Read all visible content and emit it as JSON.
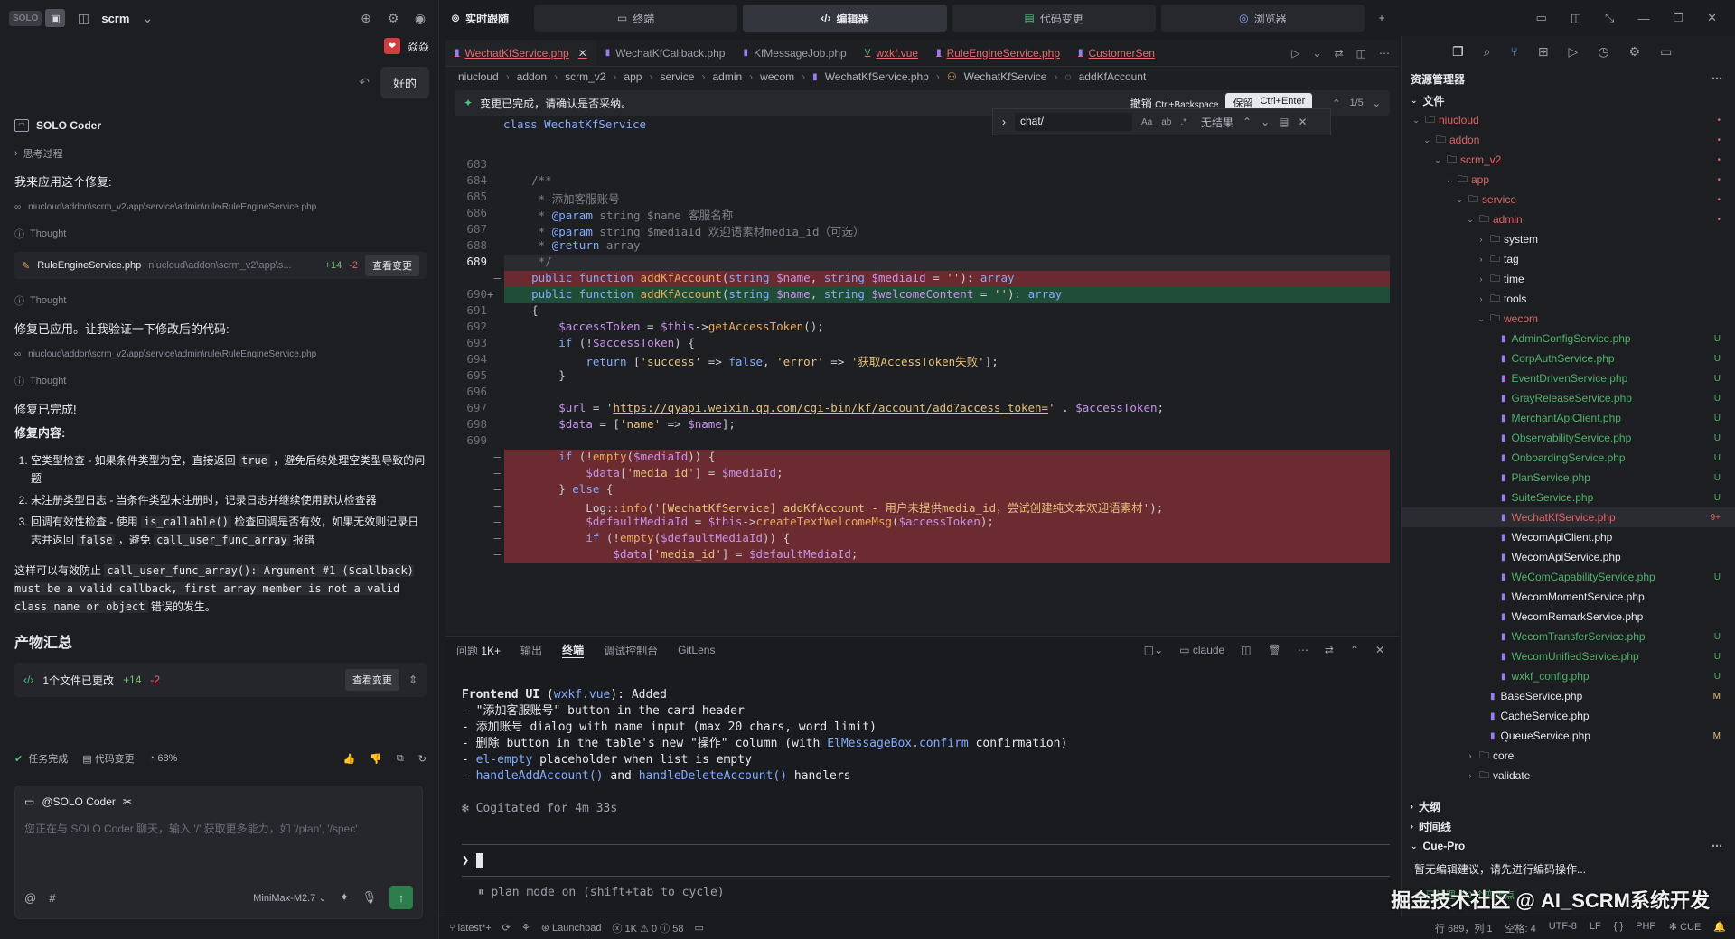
{
  "app": {
    "project": "scrm",
    "logo_text": "SOLO"
  },
  "user": {
    "name": "焱焱",
    "reply": "好的"
  },
  "chat": {
    "agent": "SOLO Coder",
    "thinking": "思考过程",
    "p1": "我来应用这个修复:",
    "ref1": "niucloud\\addon\\scrm_v2\\app\\service\\admin\\rule\\RuleEngineService.php",
    "thought1": "Thought",
    "change_file": "RuleEngineService.php",
    "change_path": "niucloud\\addon\\scrm_v2\\app\\s...",
    "change_add": "+14",
    "change_del": "-2",
    "view_changes": "查看变更",
    "thought2": "Thought",
    "p2": "修复已应用。让我验证一下修改后的代码:",
    "ref2": "niucloud\\addon\\scrm_v2\\app\\service\\admin\\rule\\RuleEngineService.php",
    "thought3": "Thought",
    "p3": "修复已完成!",
    "p4": "修复内容:",
    "item1a": "空类型检查 - 如果条件类型为空，直接返回 ",
    "item1code": "true",
    "item1b": " ，避免后续处理空类型导致的问题",
    "item2": "未注册类型日志 - 当条件类型未注册时，记录日志并继续使用默认检查器",
    "item3a": "回调有效性检查 - 使用 ",
    "item3code": "is_callable()",
    "item3b": " 检查回调是否有效，如果无效则记录日志并返回 ",
    "item3code2": "false",
    "item3c": " ，避免 ",
    "item3code3": "call_user_func_array",
    "item3d": " 报错",
    "p5a": "这样可以有效防止 ",
    "p5code": "call_user_func_array(): Argument #1 ($callback) must be a valid callback, first array member is not a valid class name or object",
    "p5b": " 错误的发生。",
    "section": "产物汇总",
    "summary_text": "1个文件已更改",
    "summary_add": "+14",
    "summary_del": "-2",
    "summary_btn": "查看变更",
    "task_done": "任务完成",
    "code_change": "代码变更",
    "progress": "68%",
    "mention": "@SOLO Coder",
    "placeholder": "您正在与 SOLO Coder 聊天，输入 '/' 获取更多能力，如 '/plan', '/spec'",
    "model": "MiniMax-M2.7"
  },
  "top_tabs": [
    "实时跟随",
    "终端",
    "编辑器",
    "代码变更",
    "浏览器"
  ],
  "editor": {
    "tabs": [
      "WechatKfService.php",
      "WechatKfCallback.php",
      "KfMessageJob.php",
      "wxkf.vue",
      "RuleEngineService.php",
      "CustomerSen"
    ],
    "crumbs": [
      "niucloud",
      "addon",
      "scrm_v2",
      "app",
      "service",
      "admin",
      "wecom",
      "WechatKfService.php",
      "WechatKfService",
      "addKfAccount"
    ],
    "banner": "变更已完成，请确认是否采纳。",
    "undo": "撤销",
    "undo_key": "Ctrl+Backspace",
    "keep": "保留",
    "keep_key": "Ctrl+Enter",
    "pager": "1/5",
    "find_value": "chat/",
    "find_result": "无结果",
    "sticky": "class WechatKfService"
  },
  "code_lines": [
    {
      "n": "683",
      "t": "",
      "k": ""
    },
    {
      "n": "684",
      "t": "    /**",
      "k": "cm"
    },
    {
      "n": "685",
      "t": "     * 添加客服账号",
      "k": "cm"
    },
    {
      "n": "686",
      "t": "     * @param string $name 客服名称",
      "k": "cm"
    },
    {
      "n": "687",
      "t": "     * @param string $mediaId 欢迎语素材media_id（可选）",
      "k": "cm"
    },
    {
      "n": "688",
      "t": "     * @return array",
      "k": "cm"
    },
    {
      "n": "689",
      "t": "     */",
      "k": "cm",
      "cls": "cur"
    },
    {
      "n": "",
      "t": "    public function addKfAccount(string $name, string $mediaId = ''): array",
      "k": "code",
      "cls": "removed"
    },
    {
      "n": "690",
      "t": "    public function addKfAccount(string $name, string $welcomeContent = ''): array",
      "k": "code",
      "cls": "added"
    },
    {
      "n": "691",
      "t": "    {",
      "k": "code"
    },
    {
      "n": "692",
      "t": "        $accessToken = $this->getAccessToken();",
      "k": "code"
    },
    {
      "n": "693",
      "t": "        if (!$accessToken) {",
      "k": "code"
    },
    {
      "n": "694",
      "t": "            return ['success' => false, 'error' => '获取AccessToken失败'];",
      "k": "code"
    },
    {
      "n": "695",
      "t": "        }",
      "k": "code"
    },
    {
      "n": "696",
      "t": "",
      "k": ""
    },
    {
      "n": "697",
      "t": "        $url = 'https://qyapi.weixin.qq.com/cgi-bin/kf/account/add?access_token=' . $accessToken;",
      "k": "code"
    },
    {
      "n": "698",
      "t": "        $data = ['name' => $name];",
      "k": "code"
    },
    {
      "n": "699",
      "t": "",
      "k": ""
    },
    {
      "n": "",
      "t": "        if (!empty($mediaId)) {",
      "k": "code",
      "cls": "rem2"
    },
    {
      "n": "",
      "t": "            $data['media_id'] = $mediaId;",
      "k": "code",
      "cls": "rem2"
    },
    {
      "n": "",
      "t": "        } else {",
      "k": "code",
      "cls": "rem2"
    },
    {
      "n": "",
      "t": "            Log::info('[WechatKfService] addKfAccount - 用户未提供media_id，尝试创建纯文本欢迎语素材');",
      "k": "code",
      "cls": "rem2"
    },
    {
      "n": "",
      "t": "            $defaultMediaId = $this->createTextWelcomeMsg($accessToken);",
      "k": "code",
      "cls": "rem2"
    },
    {
      "n": "",
      "t": "            if (!empty($defaultMediaId)) {",
      "k": "code",
      "cls": "rem2"
    },
    {
      "n": "",
      "t": "                $data['media_id'] = $defaultMediaId;",
      "k": "code",
      "cls": "rem2"
    }
  ],
  "panel": {
    "tabs": [
      "问题",
      "1K+",
      "输出",
      "终端",
      "调试控制台",
      "GitLens"
    ],
    "terminal_name": "claude",
    "out": [
      "Frontend UI (wxkf.vue): Added",
      "- \"添加客服账号\" button in the card header",
      "- 添加账号 dialog with name input (max 20 chars, word limit)",
      "- 删除 button in the table's new \"操作\" column (with ElMessageBox.confirm confirmation)",
      "- el-empty placeholder when list is empty",
      "- handleAddAccount() and handleDeleteAccount() handlers",
      "",
      "✻ Cogitated for 4m 33s"
    ],
    "prompt": "❯",
    "plan": "⏸ plan mode on (shift+tab to cycle)"
  },
  "explorer": {
    "title": "资源管理器",
    "files_label": "文件",
    "tree": [
      {
        "d": 0,
        "n": "niucloud",
        "t": "folder",
        "c": "red",
        "open": true,
        "b": "•"
      },
      {
        "d": 1,
        "n": "addon",
        "t": "folder",
        "c": "red",
        "open": true,
        "b": "•"
      },
      {
        "d": 2,
        "n": "scrm_v2",
        "t": "folder",
        "c": "red",
        "open": true,
        "b": "•"
      },
      {
        "d": 3,
        "n": "app",
        "t": "folder",
        "c": "red",
        "open": true,
        "b": "•"
      },
      {
        "d": 4,
        "n": "service",
        "t": "folder",
        "c": "red",
        "open": true,
        "b": "•"
      },
      {
        "d": 5,
        "n": "admin",
        "t": "folder",
        "c": "red",
        "open": true,
        "b": "•"
      },
      {
        "d": 6,
        "n": "system",
        "t": "folder",
        "c": "",
        "open": false,
        "b": ""
      },
      {
        "d": 6,
        "n": "tag",
        "t": "folder",
        "c": "",
        "open": false,
        "b": ""
      },
      {
        "d": 6,
        "n": "time",
        "t": "folder",
        "c": "",
        "open": false,
        "b": ""
      },
      {
        "d": 6,
        "n": "tools",
        "t": "folder",
        "c": "",
        "open": false,
        "b": ""
      },
      {
        "d": 6,
        "n": "wecom",
        "t": "folder",
        "c": "red",
        "open": true,
        "b": ""
      },
      {
        "d": 7,
        "n": "AdminConfigService.php",
        "t": "php",
        "c": "grn",
        "b": "U"
      },
      {
        "d": 7,
        "n": "CorpAuthService.php",
        "t": "php",
        "c": "grn",
        "b": "U"
      },
      {
        "d": 7,
        "n": "EventDrivenService.php",
        "t": "php",
        "c": "grn",
        "b": "U"
      },
      {
        "d": 7,
        "n": "GrayReleaseService.php",
        "t": "php",
        "c": "grn",
        "b": "U"
      },
      {
        "d": 7,
        "n": "MerchantApiClient.php",
        "t": "php",
        "c": "grn",
        "b": "U"
      },
      {
        "d": 7,
        "n": "ObservabilityService.php",
        "t": "php",
        "c": "grn",
        "b": "U"
      },
      {
        "d": 7,
        "n": "OnboardingService.php",
        "t": "php",
        "c": "grn",
        "b": "U"
      },
      {
        "d": 7,
        "n": "PlanService.php",
        "t": "php",
        "c": "grn",
        "b": "U"
      },
      {
        "d": 7,
        "n": "SuiteService.php",
        "t": "php",
        "c": "grn",
        "b": "U"
      },
      {
        "d": 7,
        "n": "WechatKfService.php",
        "t": "php",
        "c": "red",
        "b": "9+",
        "sel": true
      },
      {
        "d": 7,
        "n": "WecomApiClient.php",
        "t": "php",
        "c": "",
        "b": ""
      },
      {
        "d": 7,
        "n": "WecomApiService.php",
        "t": "php",
        "c": "",
        "b": ""
      },
      {
        "d": 7,
        "n": "WeComCapabilityService.php",
        "t": "php",
        "c": "grn",
        "b": "U"
      },
      {
        "d": 7,
        "n": "WecomMomentService.php",
        "t": "php",
        "c": "",
        "b": ""
      },
      {
        "d": 7,
        "n": "WecomRemarkService.php",
        "t": "php",
        "c": "",
        "b": ""
      },
      {
        "d": 7,
        "n": "WecomTransferService.php",
        "t": "php",
        "c": "grn",
        "b": "U"
      },
      {
        "d": 7,
        "n": "WecomUnifiedService.php",
        "t": "php",
        "c": "grn",
        "b": "U"
      },
      {
        "d": 7,
        "n": "wxkf_config.php",
        "t": "php",
        "c": "grn",
        "b": "U"
      },
      {
        "d": 6,
        "n": "BaseService.php",
        "t": "php",
        "c": "",
        "b": "M"
      },
      {
        "d": 6,
        "n": "CacheService.php",
        "t": "php",
        "c": "",
        "b": ""
      },
      {
        "d": 6,
        "n": "QueueService.php",
        "t": "php",
        "c": "",
        "b": "M"
      },
      {
        "d": 5,
        "n": "core",
        "t": "folder",
        "c": "",
        "open": false,
        "b": ""
      },
      {
        "d": 5,
        "n": "validate",
        "t": "folder",
        "c": "",
        "open": false,
        "b": ""
      }
    ],
    "outline": "大纲",
    "timeline": "时间线",
    "cue": "Cue-Pro",
    "cue_msg": "暂无编辑建议，请先进行编码操作...",
    "cue_stat": "已处理 0/0 个变更点"
  },
  "statusbar": {
    "branch": "latest*+",
    "launch": "Launchpad",
    "errors": "1K",
    "warnings": "0",
    "info": "58",
    "pos": "行 689，列 1",
    "spaces": "空格: 4",
    "enc": "UTF-8",
    "eol": "LF",
    "braces": "{ }",
    "lang": "PHP",
    "cue": "CUE"
  },
  "watermark": "掘金技术社区 @ AI_SCRM系统开发"
}
